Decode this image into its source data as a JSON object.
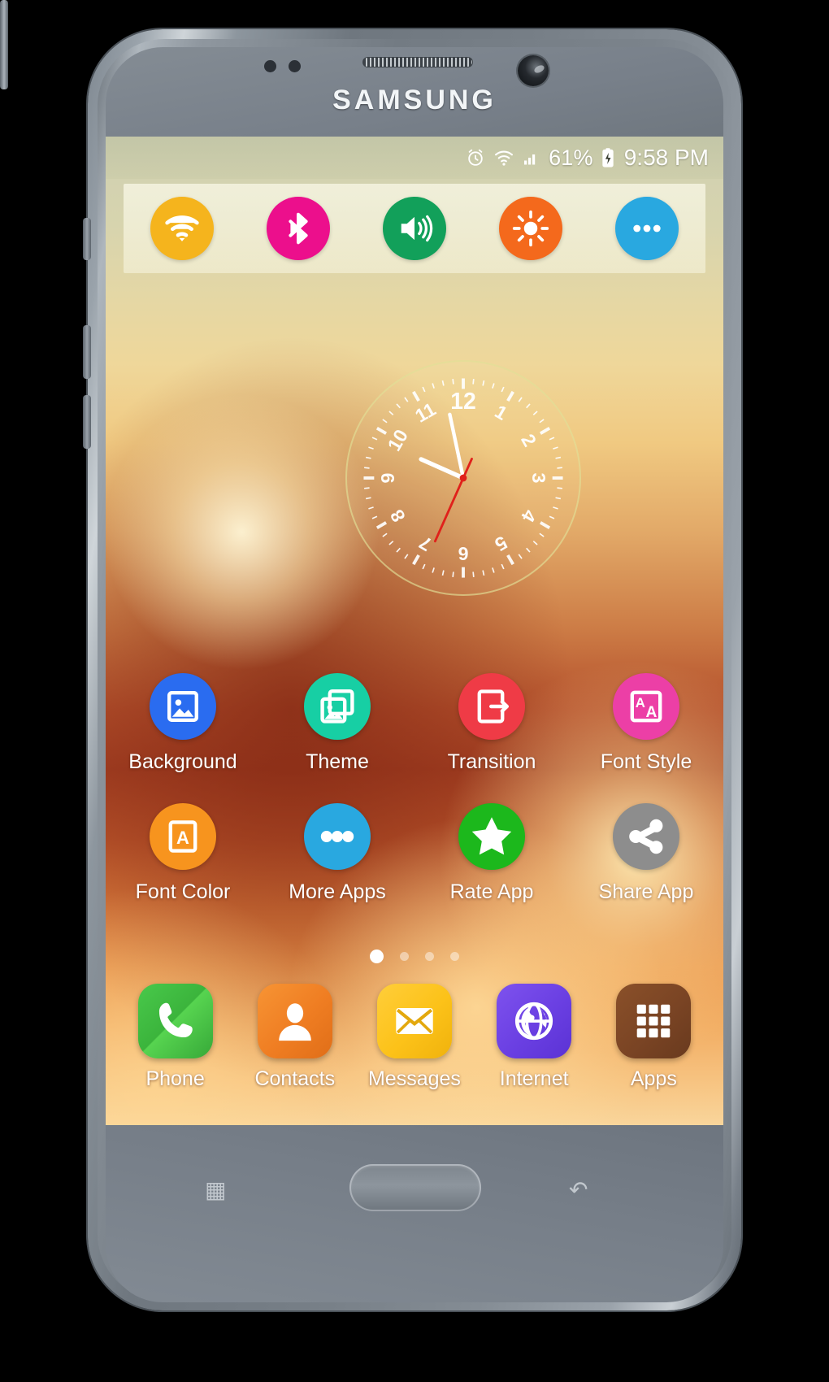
{
  "device": {
    "brand": "SAMSUNG",
    "nav_recent_icon": "recents-icon",
    "nav_back_icon": "back-icon"
  },
  "status_bar": {
    "alarm_icon": "alarm-icon",
    "wifi_icon": "wifi-icon",
    "signal_icon": "signal-bars-icon",
    "battery_percent": "61%",
    "battery_icon": "battery-charging-icon",
    "time": "9:58 PM"
  },
  "quick_settings": {
    "items": [
      {
        "name": "wifi",
        "label": "Wi-Fi",
        "icon": "wifi-icon",
        "color": "#f5b41d"
      },
      {
        "name": "bluetooth",
        "label": "Bluetooth",
        "icon": "bluetooth-icon",
        "color": "#ec0f8c"
      },
      {
        "name": "volume",
        "label": "Volume",
        "icon": "volume-icon",
        "color": "#12a05a"
      },
      {
        "name": "brightness",
        "label": "Brightness",
        "icon": "brightness-icon",
        "color": "#f4691c"
      },
      {
        "name": "more",
        "label": "More",
        "icon": "more-dots-icon",
        "color": "#29a8e0"
      }
    ]
  },
  "clock_widget": {
    "type": "analog",
    "hour_numerals": [
      "12",
      "1",
      "2",
      "3",
      "4",
      "5",
      "6",
      "7",
      "8",
      "9",
      "10",
      "11"
    ],
    "hour_hand_deg": 294,
    "minute_hand_deg": 348,
    "second_hand_deg": 204,
    "hand_color": "#ffffff",
    "second_hand_color": "#e0211b",
    "ring_color": "#e0de96"
  },
  "home_grid": {
    "rows": [
      [
        {
          "label": "Background",
          "icon": "image-icon",
          "color": "#2a6cf0"
        },
        {
          "label": "Theme",
          "icon": "images-stack-icon",
          "color": "#17cfa4"
        },
        {
          "label": "Transition",
          "icon": "transition-icon",
          "color": "#ef3b46"
        },
        {
          "label": "Font Style",
          "icon": "font-style-icon",
          "color": "#ec3fa6"
        }
      ],
      [
        {
          "label": "Font Color",
          "icon": "font-color-icon",
          "color": "#f7941e"
        },
        {
          "label": "More Apps",
          "icon": "more-dots-icon",
          "color": "#29a8e0"
        },
        {
          "label": "Rate App",
          "icon": "star-icon",
          "color": "#1cb81c"
        },
        {
          "label": "Share App",
          "icon": "share-icon",
          "color": "#8d8d8d"
        }
      ]
    ]
  },
  "page_indicator": {
    "total": 4,
    "active_index": 0
  },
  "dock": {
    "items": [
      {
        "label": "Phone",
        "icon": "phone-icon",
        "color": "#3fb83f"
      },
      {
        "label": "Contacts",
        "icon": "contact-icon",
        "color": "#f2842a"
      },
      {
        "label": "Messages",
        "icon": "envelope-icon",
        "color": "#fcc418"
      },
      {
        "label": "Internet",
        "icon": "globe-icon",
        "color": "#6b42e0"
      },
      {
        "label": "Apps",
        "icon": "apps-grid-icon",
        "color": "#7a4424"
      }
    ]
  }
}
